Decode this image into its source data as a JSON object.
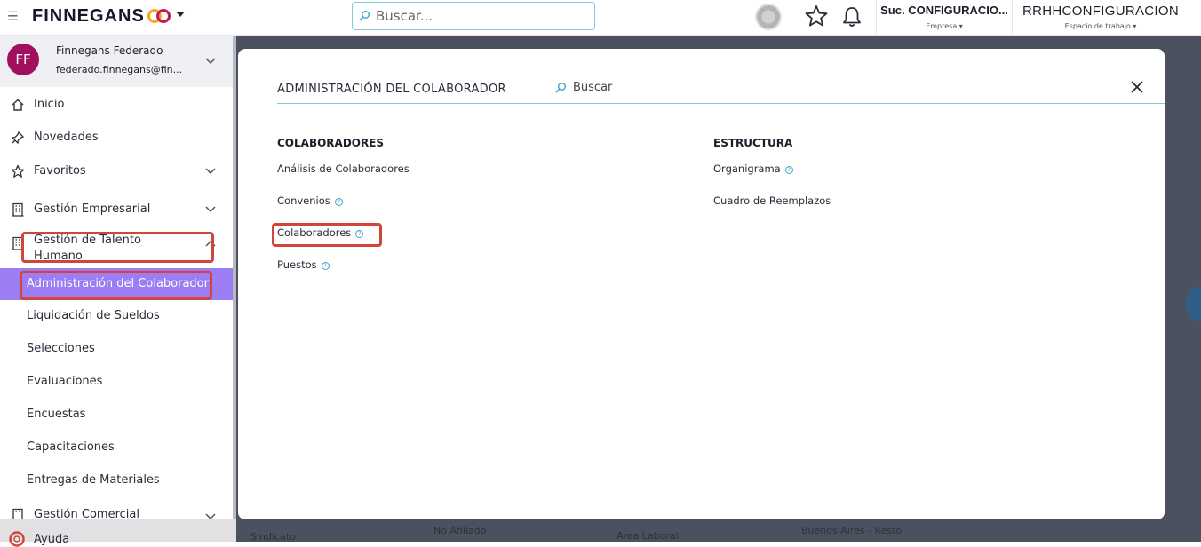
{
  "header": {
    "brand": "FINNEGANS",
    "search_placeholder": "Buscar...",
    "company": {
      "value": "Suc. CONFIGURACIO...",
      "label": "Empresa"
    },
    "workspace": {
      "value": "RRHHCONFIGURACION",
      "label": "Espacio de trabajo"
    },
    "icons": [
      "menu-icon",
      "logo-icon",
      "chevron-down-icon",
      "search-icon",
      "loader-icon",
      "star-icon",
      "bell-icon"
    ]
  },
  "sidebar": {
    "profile": {
      "initials": "FF",
      "name": "Finnegans Federado",
      "email": "federado.finnegans@fin..."
    },
    "items": [
      {
        "label": "Inicio",
        "icon": "home-icon"
      },
      {
        "label": "Novedades",
        "icon": "pin-icon"
      },
      {
        "label": "Favoritos",
        "icon": "star-icon"
      },
      {
        "label": "Gestión Empresarial",
        "icon": "building-icon"
      },
      {
        "label": "Gestión de Talento Humano",
        "icon": "building-icon"
      }
    ],
    "subitems": [
      "Administración del Colaborador",
      "Liquidación de Sueldos",
      "Selecciones",
      "Evaluaciones",
      "Encuestas",
      "Capacitaciones",
      "Entregas de Materiales"
    ],
    "more": "Gestión Comercial",
    "help": "Ayuda"
  },
  "modal": {
    "title": "ADMINISTRACIÓN DEL COLABORADOR",
    "search_placeholder": "Buscar",
    "col1": {
      "header": "COLABORADORES",
      "items": [
        "Análisis de Colaboradores",
        "Convenios",
        "Colaboradores",
        "Puestos"
      ]
    },
    "col2": {
      "header": "ESTRUCTURA",
      "items": [
        "Organigrama",
        "Cuadro de Reemplazos"
      ]
    },
    "help_glyph": "?"
  },
  "background": {
    "cells": [
      "Sindicato",
      "No Afiliado",
      "Area Laboral",
      "Buenos Aires - Resto"
    ]
  },
  "colors": {
    "accent": "#9c7df3",
    "highlight": "#d0463a",
    "search_border": "#7fc9dc",
    "avatar": "#a0105f"
  }
}
